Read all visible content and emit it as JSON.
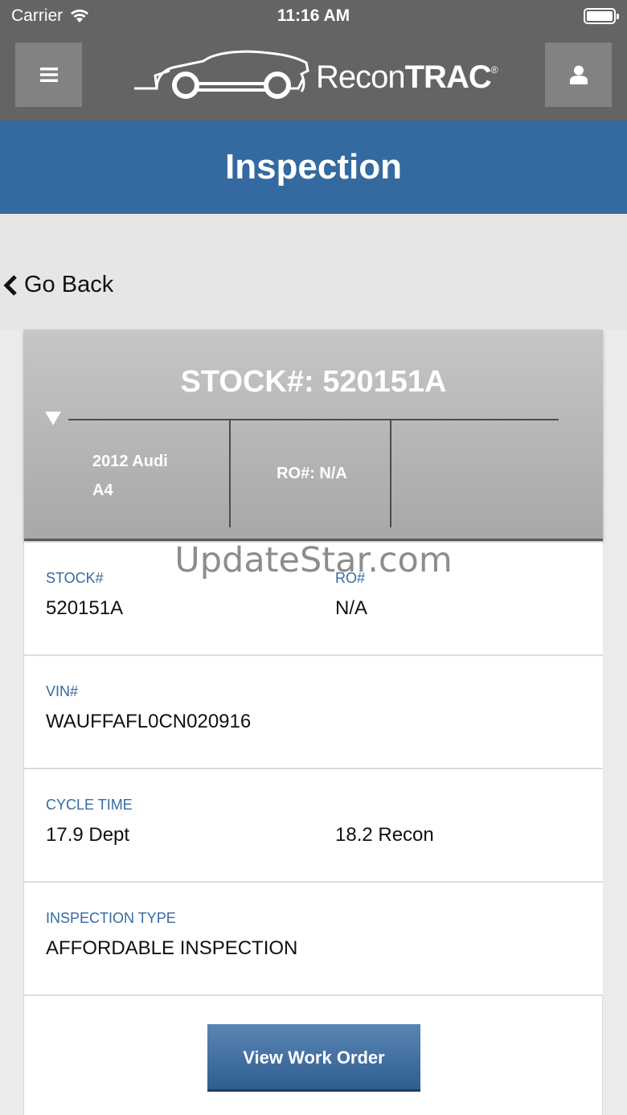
{
  "status_bar": {
    "carrier": "Carrier",
    "time": "11:16 AM",
    "battery": 1.0
  },
  "header": {
    "logo_text_light": "Recon",
    "logo_text_bold": "TRAC",
    "logo_mark": "®",
    "menu_icon": "hamburger-icon",
    "user_icon": "user-icon"
  },
  "page_title": "Inspection",
  "nav": {
    "back_label": "Go Back"
  },
  "summary": {
    "stock_title": "STOCK#: 520151A",
    "vehicle_year_make": "2012 Audi",
    "vehicle_model": "A4",
    "ro": "RO#: N/A"
  },
  "watermark": "UpdateStar.com",
  "details": {
    "stock_label": "STOCK#",
    "stock_value": "520151A",
    "ro_label": "RO#",
    "ro_value": "N/A",
    "vin_label": "VIN#",
    "vin_value": "WAUFFAFL0CN020916",
    "cycle_label": "CYCLE TIME",
    "cycle_dept": "17.9 Dept",
    "cycle_recon": "18.2 Recon",
    "inspection_label": "INSPECTION TYPE",
    "inspection_value": "AFFORDABLE INSPECTION"
  },
  "actions": {
    "view_work_order": "View Work Order"
  },
  "colors": {
    "header_gray": "#646464",
    "title_blue": "#356aa0",
    "button_blue": "#356aa0"
  }
}
